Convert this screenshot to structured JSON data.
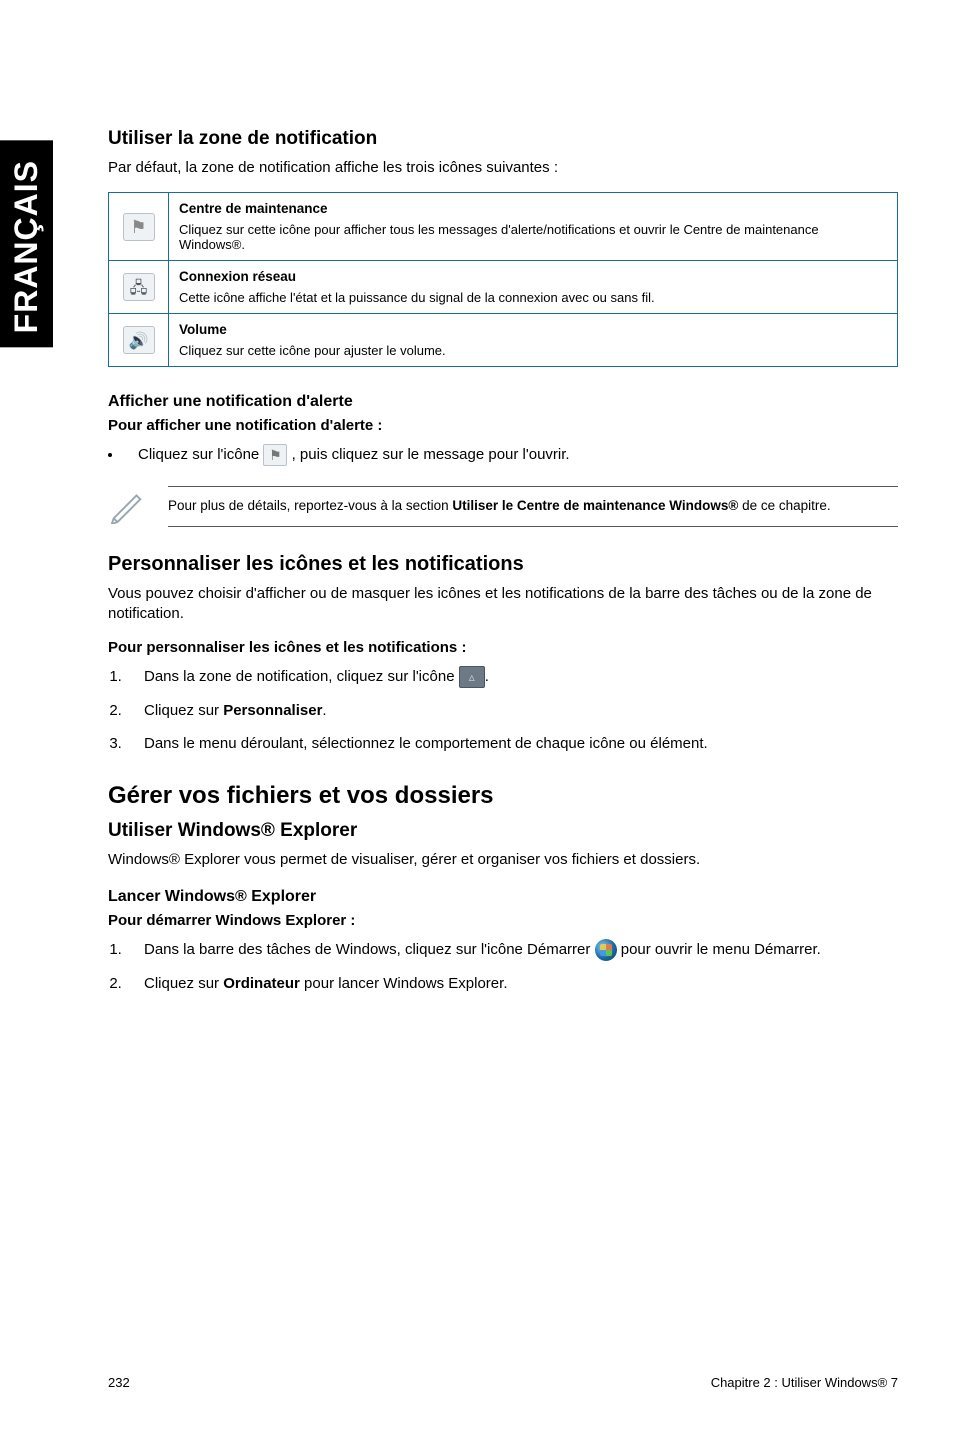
{
  "sidetab": "FRANÇAIS",
  "s1": {
    "title": "Utiliser la zone de notification",
    "intro": "Par défaut, la zone de notification affiche les trois icônes suivantes :",
    "table": {
      "row1": {
        "title": "Centre de maintenance",
        "desc": "Cliquez sur cette icône pour afficher tous les messages d'alerte/notifications et ouvrir le Centre de maintenance Windows®."
      },
      "row2": {
        "title": "Connexion réseau",
        "desc": "Cette icône affiche l'état et la puissance du signal de la connexion avec ou sans fil."
      },
      "row3": {
        "title": "Volume",
        "desc": "Cliquez sur cette icône pour ajuster le volume."
      }
    }
  },
  "s2": {
    "title": "Afficher une notification d'alerte",
    "lead": "Pour afficher une notification d'alerte :",
    "bullet_pre": "Cliquez sur l'icône ",
    "bullet_post": ", puis cliquez sur le message pour l'ouvrir.",
    "note_pre": "Pour plus de détails, reportez-vous à la section ",
    "note_bold": "Utiliser le Centre de maintenance Windows®",
    "note_post": " de ce chapitre."
  },
  "s3": {
    "title": "Personnaliser les icônes et les notifications",
    "intro": "Vous pouvez choisir d'afficher ou de masquer les icônes et les notifications de la barre des tâches ou de la zone de notification.",
    "lead": "Pour personnaliser les icônes et les notifications :",
    "step1_pre": "Dans la zone de notification, cliquez sur l'icône ",
    "step1_post": ".",
    "step2_pre": "Cliquez sur ",
    "step2_bold": "Personnaliser",
    "step2_post": ".",
    "step3": "Dans le menu déroulant, sélectionnez le comportement de chaque icône ou élément."
  },
  "s4": {
    "title": "Gérer vos fichiers et vos dossiers",
    "sub1": "Utiliser Windows® Explorer",
    "sub1_text": "Windows® Explorer vous permet de visualiser, gérer et organiser vos fichiers et dossiers.",
    "sub2": "Lancer Windows® Explorer",
    "sub2_lead": "Pour démarrer Windows Explorer :",
    "step1_pre": "Dans la barre des tâches de Windows, cliquez sur l'icône Démarrer ",
    "step1_post": " pour ouvrir le menu Démarrer.",
    "step2_pre": "Cliquez sur ",
    "step2_bold": "Ordinateur",
    "step2_post": " pour lancer Windows Explorer."
  },
  "footer": {
    "page": "232",
    "chapter": "Chapitre 2 : Utiliser Windows® 7"
  }
}
